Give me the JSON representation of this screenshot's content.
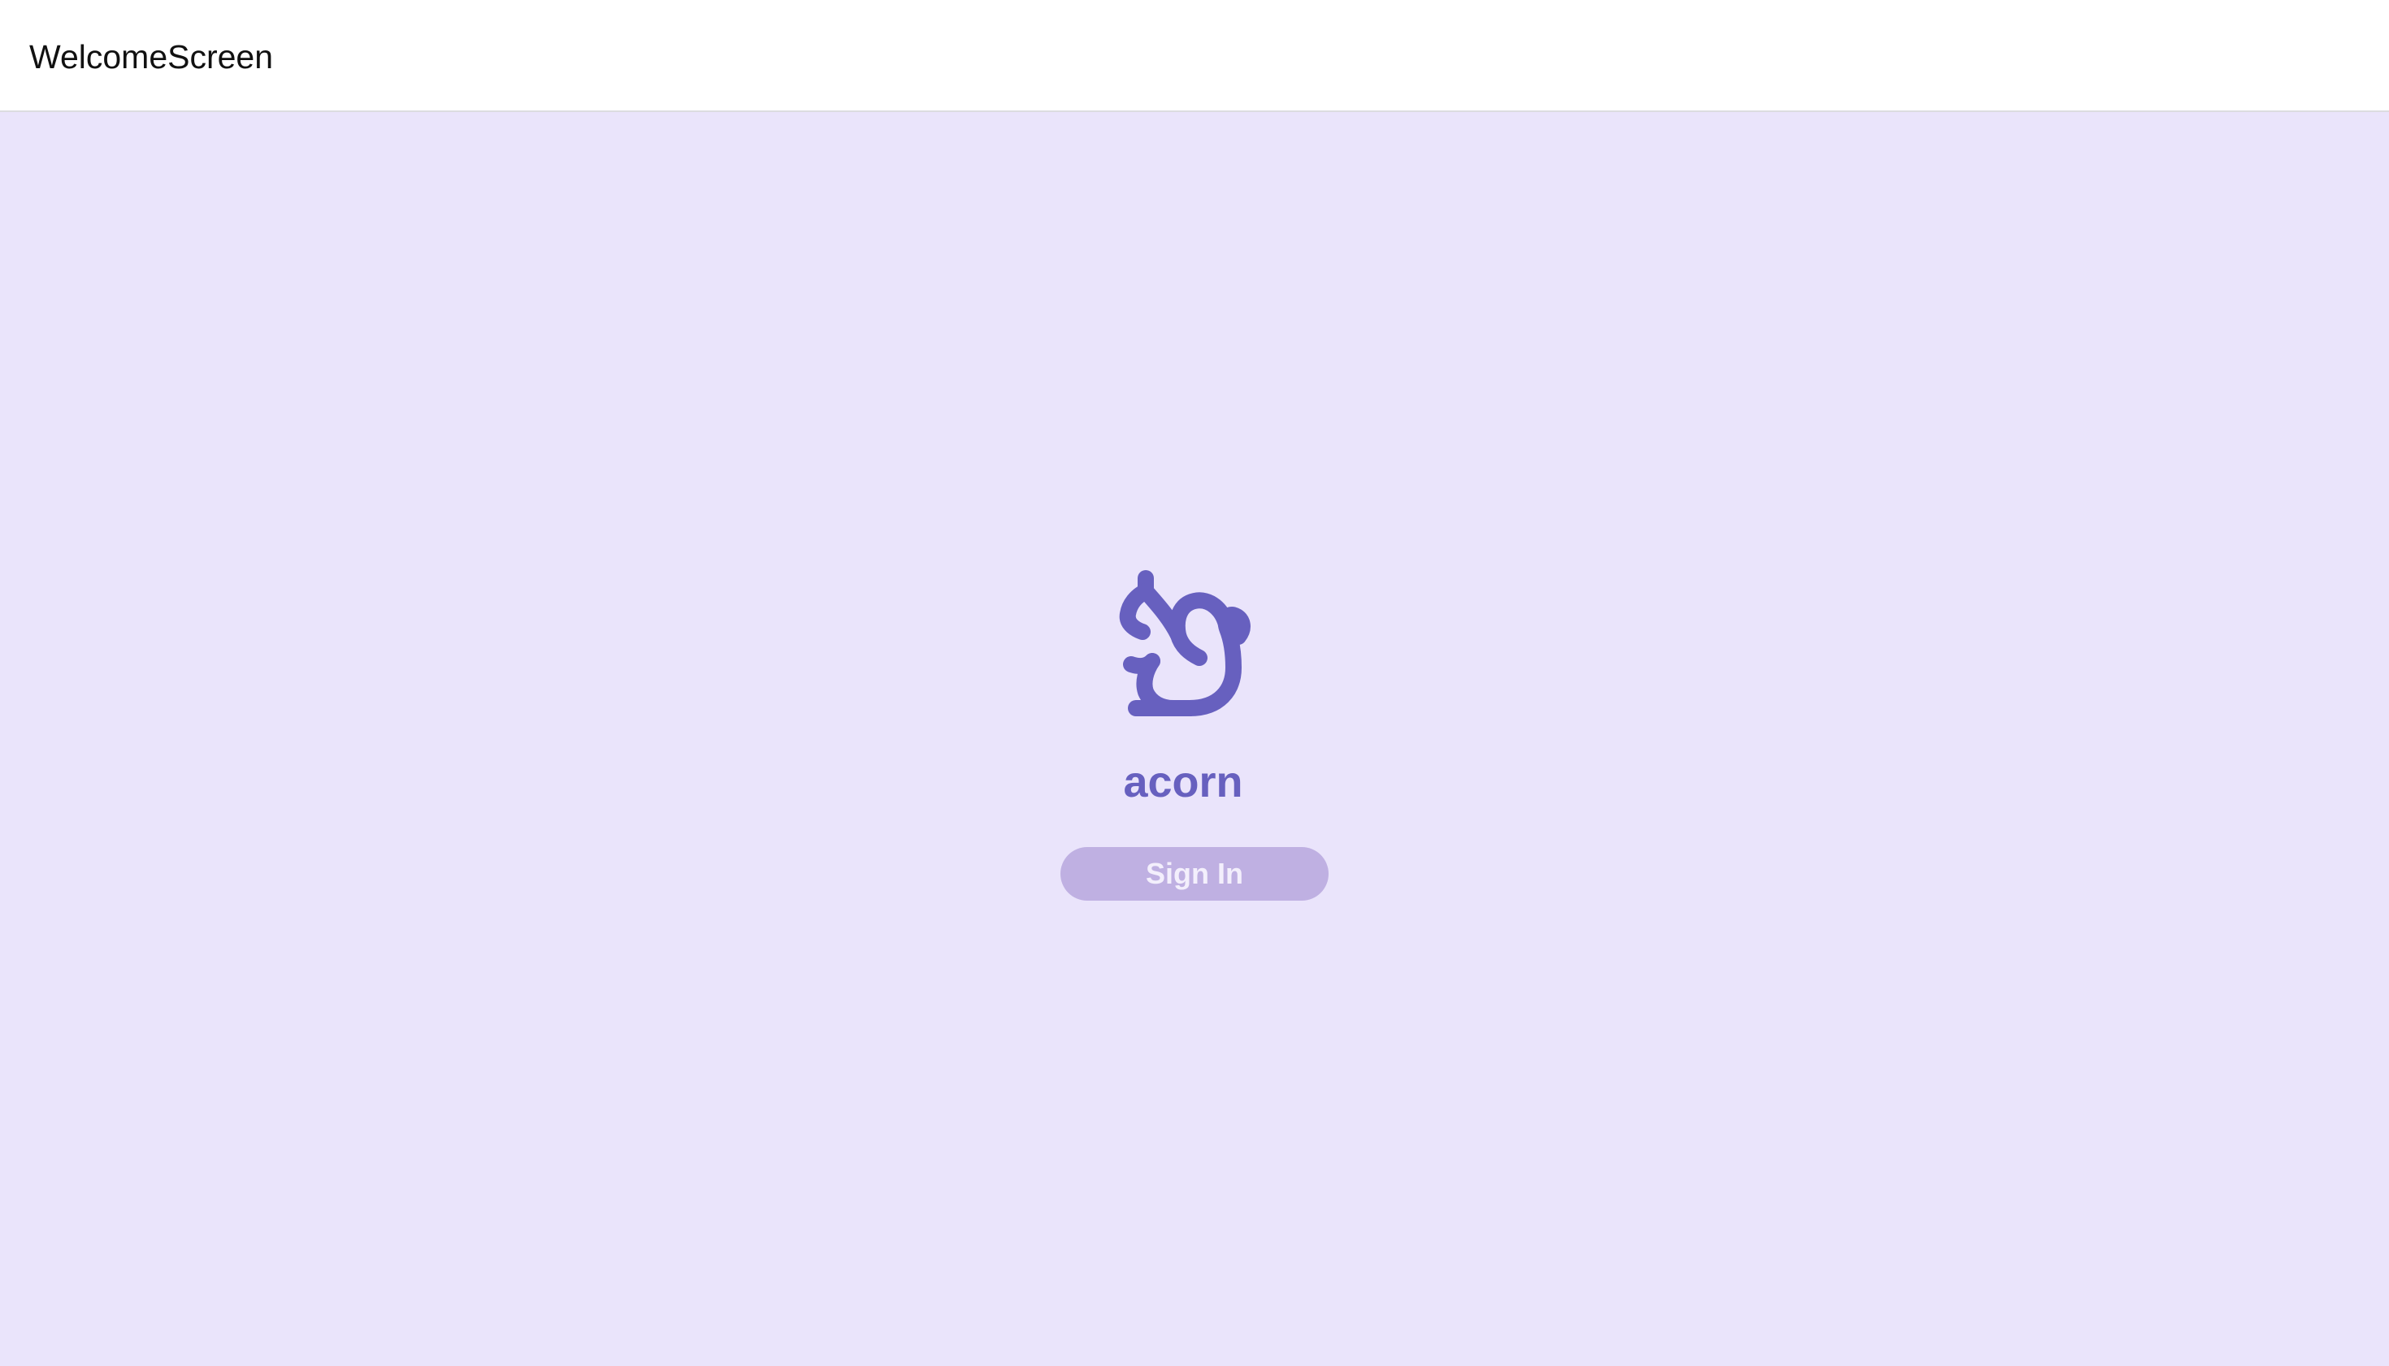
{
  "window": {
    "title": "WelcomeScreen"
  },
  "brand": {
    "logo_icon": "squirrel-icon",
    "wordmark": "acorn"
  },
  "actions": {
    "sign_in_label": "Sign In"
  },
  "colors": {
    "background": "#EAE4FB",
    "brand_purple": "#6760BF",
    "button_fill": "#BFB0E2",
    "button_text": "#F3EFFC"
  }
}
